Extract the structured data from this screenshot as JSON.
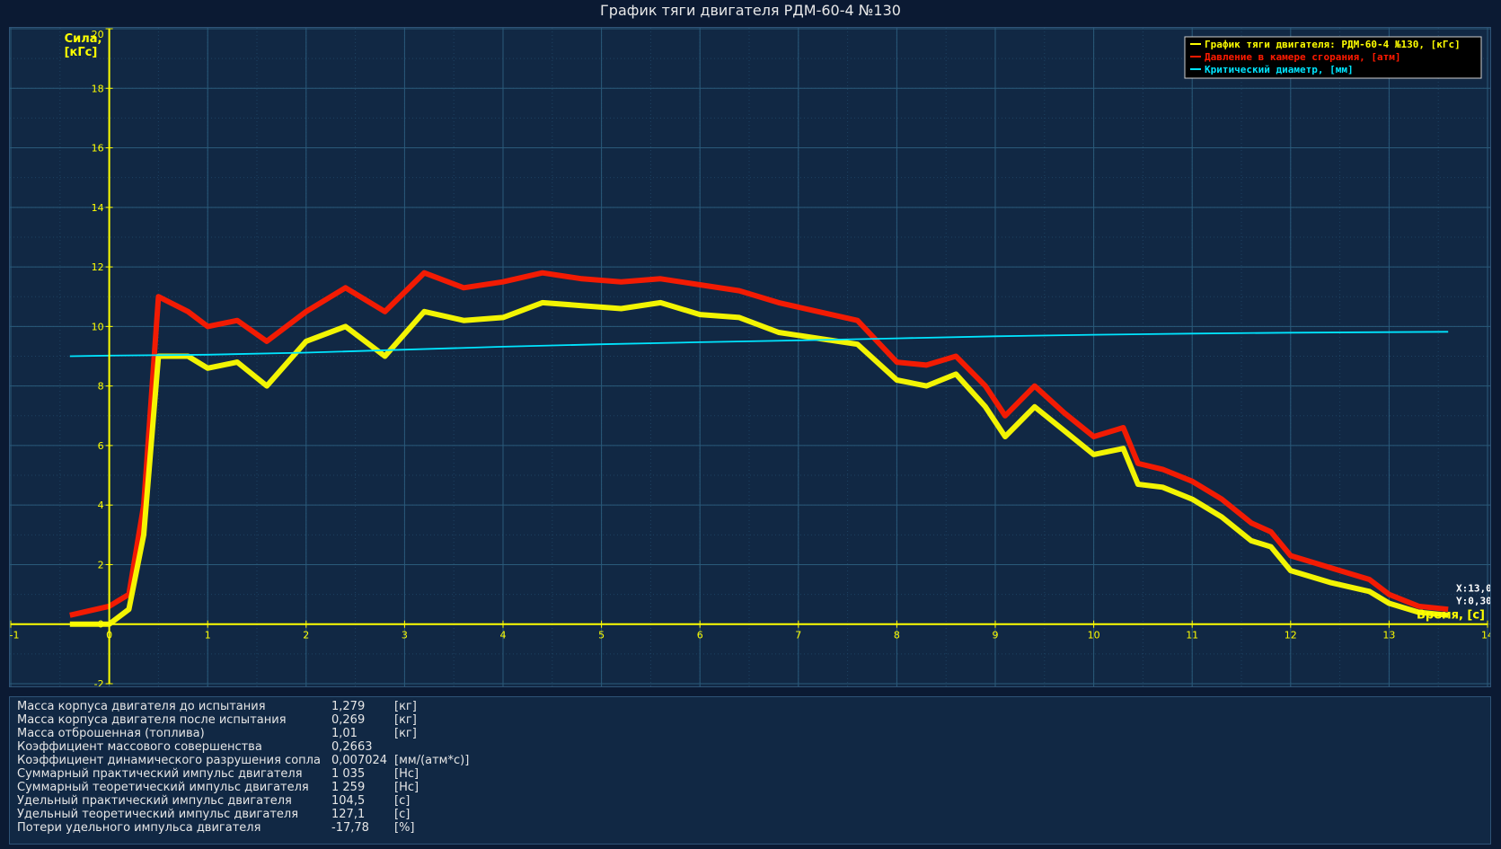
{
  "title": "График тяги двигателя РДМ-60-4 №130",
  "colors": {
    "background": "#0b1a33",
    "plot_bg": "#112844",
    "grid": "#2a5a7a",
    "axis": "#ffff00",
    "thrust": "#ffff00",
    "pressure": "#ff1a00",
    "diameter": "#00e5ff"
  },
  "chart_data": {
    "type": "line",
    "title": "График тяги двигателя РДМ-60-4 №130",
    "xlabel": "Время, [с]",
    "ylabel": "Сила, [кГс]",
    "xlim": [
      -1,
      14
    ],
    "ylim": [
      -2,
      20
    ],
    "x_ticks": [
      "-1",
      "0",
      "1",
      "2",
      "3",
      "4",
      "5",
      "6",
      "7",
      "8",
      "9",
      "10",
      "11",
      "12",
      "13",
      "14"
    ],
    "y_ticks": [
      "-2",
      "0",
      "2",
      "4",
      "6",
      "8",
      "10",
      "12",
      "14",
      "16",
      "18",
      "20"
    ],
    "grid": true,
    "legend_position": "top-right",
    "cursor": {
      "x_text": "X:13,0",
      "y_text": "Y:0,30"
    },
    "series": [
      {
        "name": "График тяги двигателя: РДМ-60-4 №130, [кГс]",
        "color": "#ffff00",
        "x": [
          -0.4,
          0.0,
          0.2,
          0.35,
          0.5,
          0.8,
          1.0,
          1.3,
          1.6,
          2.0,
          2.4,
          2.8,
          3.2,
          3.6,
          4.0,
          4.4,
          4.8,
          5.2,
          5.6,
          6.0,
          6.4,
          6.8,
          7.2,
          7.6,
          8.0,
          8.3,
          8.6,
          8.9,
          9.1,
          9.4,
          9.7,
          10.0,
          10.3,
          10.45,
          10.7,
          11.0,
          11.3,
          11.6,
          11.8,
          12.0,
          12.4,
          12.8,
          13.0,
          13.3,
          13.6
        ],
        "y": [
          0.0,
          0.0,
          0.5,
          3.0,
          9.0,
          9.0,
          8.6,
          8.8,
          8.0,
          9.5,
          10.0,
          9.0,
          10.5,
          10.2,
          10.3,
          10.8,
          10.7,
          10.6,
          10.8,
          10.4,
          10.3,
          9.8,
          9.6,
          9.4,
          8.2,
          8.0,
          8.4,
          7.3,
          6.3,
          7.3,
          6.5,
          5.7,
          5.9,
          4.7,
          4.6,
          4.2,
          3.6,
          2.8,
          2.6,
          1.8,
          1.4,
          1.1,
          0.7,
          0.4,
          0.3
        ]
      },
      {
        "name": "Давление в камере сгорания, [атм]",
        "color": "#ff1a00",
        "x": [
          -0.4,
          0.0,
          0.2,
          0.35,
          0.5,
          0.8,
          1.0,
          1.3,
          1.6,
          2.0,
          2.4,
          2.8,
          3.2,
          3.6,
          4.0,
          4.4,
          4.8,
          5.2,
          5.6,
          6.0,
          6.4,
          6.8,
          7.2,
          7.6,
          8.0,
          8.3,
          8.6,
          8.9,
          9.1,
          9.4,
          9.7,
          10.0,
          10.3,
          10.45,
          10.7,
          11.0,
          11.3,
          11.6,
          11.8,
          12.0,
          12.4,
          12.8,
          13.0,
          13.3,
          13.6
        ],
        "y": [
          0.3,
          0.6,
          1.0,
          4.0,
          11.0,
          10.5,
          10.0,
          10.2,
          9.5,
          10.5,
          11.3,
          10.5,
          11.8,
          11.3,
          11.5,
          11.8,
          11.6,
          11.5,
          11.6,
          11.4,
          11.2,
          10.8,
          10.5,
          10.2,
          8.8,
          8.7,
          9.0,
          8.0,
          7.0,
          8.0,
          7.1,
          6.3,
          6.6,
          5.4,
          5.2,
          4.8,
          4.2,
          3.4,
          3.1,
          2.3,
          1.9,
          1.5,
          1.0,
          0.6,
          0.5
        ]
      },
      {
        "name": "Критический диаметр, [мм]",
        "color": "#00e5ff",
        "x": [
          -0.4,
          0,
          1,
          2,
          3,
          4,
          5,
          6,
          7,
          8,
          9,
          10,
          11,
          12,
          13,
          13.6
        ],
        "y": [
          9.0,
          9.02,
          9.05,
          9.12,
          9.22,
          9.32,
          9.4,
          9.47,
          9.53,
          9.6,
          9.67,
          9.72,
          9.76,
          9.79,
          9.81,
          9.82
        ]
      }
    ]
  },
  "stats": [
    {
      "label": "Масса корпуса двигателя до испытания",
      "value": "1,279",
      "unit": "[кг]"
    },
    {
      "label": "Масса корпуса двигателя после испытания",
      "value": "0,269",
      "unit": "[кг]"
    },
    {
      "label": "Масса отброшенная (топлива)",
      "value": "1,01",
      "unit": "[кг]"
    },
    {
      "label": "Коэффициент массового совершенства",
      "value": "0,2663",
      "unit": ""
    },
    {
      "label": "Коэффициент динамического разрушения сопла",
      "value": "0,007024",
      "unit": "[мм/(атм*с)]"
    },
    {
      "label": "Суммарный практический импульс двигателя",
      "value": "1 035",
      "unit": "[Нс]"
    },
    {
      "label": "Суммарный теоретический импульс двигателя",
      "value": "1 259",
      "unit": "[Нс]"
    },
    {
      "label": "Удельный практический импульс двигателя",
      "value": "104,5",
      "unit": "[с]"
    },
    {
      "label": "Удельный теоретический импульс двигателя",
      "value": "127,1",
      "unit": "[с]"
    },
    {
      "label": "Потери удельного импульса двигателя",
      "value": "-17,78",
      "unit": "[%]"
    }
  ]
}
